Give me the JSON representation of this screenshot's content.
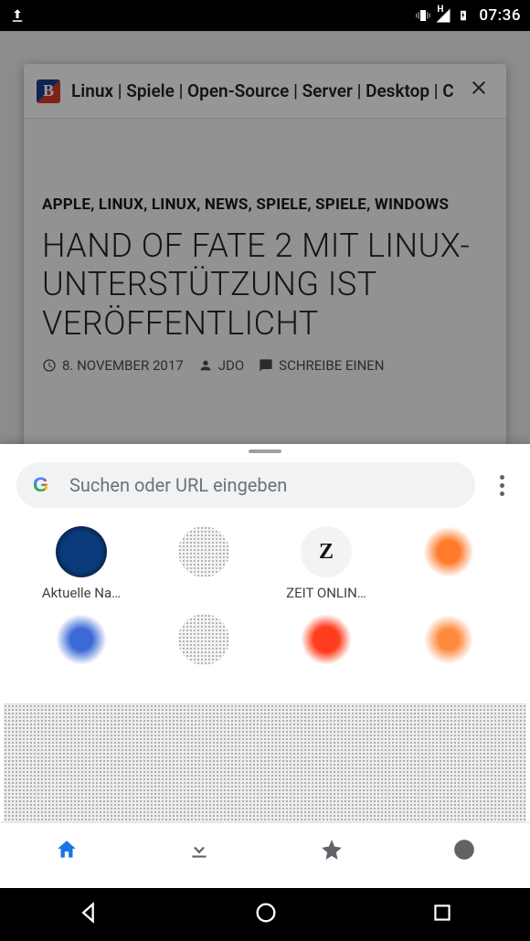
{
  "status_bar": {
    "time": "07:36",
    "network_label": "H"
  },
  "background_tab": {
    "site_title": "Linux | Spiele | Open-Source | Server | Desktop | Cloud",
    "logo_letter": "B",
    "categories": [
      "APPLE",
      "LINUX",
      "LINUX",
      "NEWS",
      "SPIELE",
      "SPIELE",
      "WINDOWS"
    ],
    "headline": "HAND OF FATE 2 MIT LINUX-UNTERSTÜTZUNG IST VERÖFFENTLICHT",
    "meta": {
      "date": "8. NOVEMBER 2017",
      "author": "JDO",
      "comments_label": "SCHREIBE EINEN"
    }
  },
  "ntp": {
    "search_placeholder": "Suchen oder URL eingeben",
    "shortcuts": [
      {
        "label": "Aktuelle Na…",
        "glyph": ""
      },
      {
        "label": "",
        "glyph": ""
      },
      {
        "label": "ZEIT ONLIN…",
        "glyph": "Z"
      },
      {
        "label": "",
        "glyph": ""
      },
      {
        "label": "",
        "glyph": ""
      },
      {
        "label": "",
        "glyph": ""
      },
      {
        "label": "",
        "glyph": ""
      },
      {
        "label": "",
        "glyph": ""
      }
    ]
  }
}
